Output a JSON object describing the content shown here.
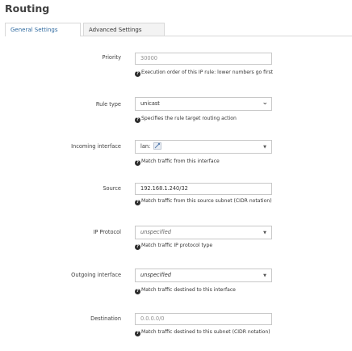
{
  "page": {
    "title": "Routing"
  },
  "tabs": [
    {
      "label": "General Settings",
      "active": true
    },
    {
      "label": "Advanced Settings",
      "active": false
    }
  ],
  "form": {
    "priority": {
      "label": "Priority",
      "value": "30000",
      "help": "Execution order of this IP rule: lower numbers go first"
    },
    "rule_type": {
      "label": "Rule type",
      "value": "unicast",
      "help": "Specifies the rule target routing action"
    },
    "incoming_interface": {
      "label": "Incoming interface",
      "value": "lan:",
      "icon": "network-interface-icon",
      "help": "Match traffic from this interface"
    },
    "source": {
      "label": "Source",
      "value": "192.168.1.240/32",
      "help": "Match traffic from this source subnet (CIDR notation)"
    },
    "ip_protocol": {
      "label": "IP Protocol",
      "value": "unspecified",
      "help": "Match traffic IP protocol type"
    },
    "outgoing_interface": {
      "label": "Outgoing interface",
      "value": "unspecified",
      "help": "Match traffic destined to this interface"
    },
    "destination": {
      "label": "Destination",
      "placeholder": "0.0.0.0/0",
      "help": "Match traffic destined to this subnet (CIDR notation)"
    }
  },
  "icons": {
    "help": "question-circle-icon",
    "dropdown": "chevron-down-icon"
  },
  "colors": {
    "active_tab_text": "#2f6aa0",
    "border": "#c8c8c8",
    "text": "#404040"
  }
}
